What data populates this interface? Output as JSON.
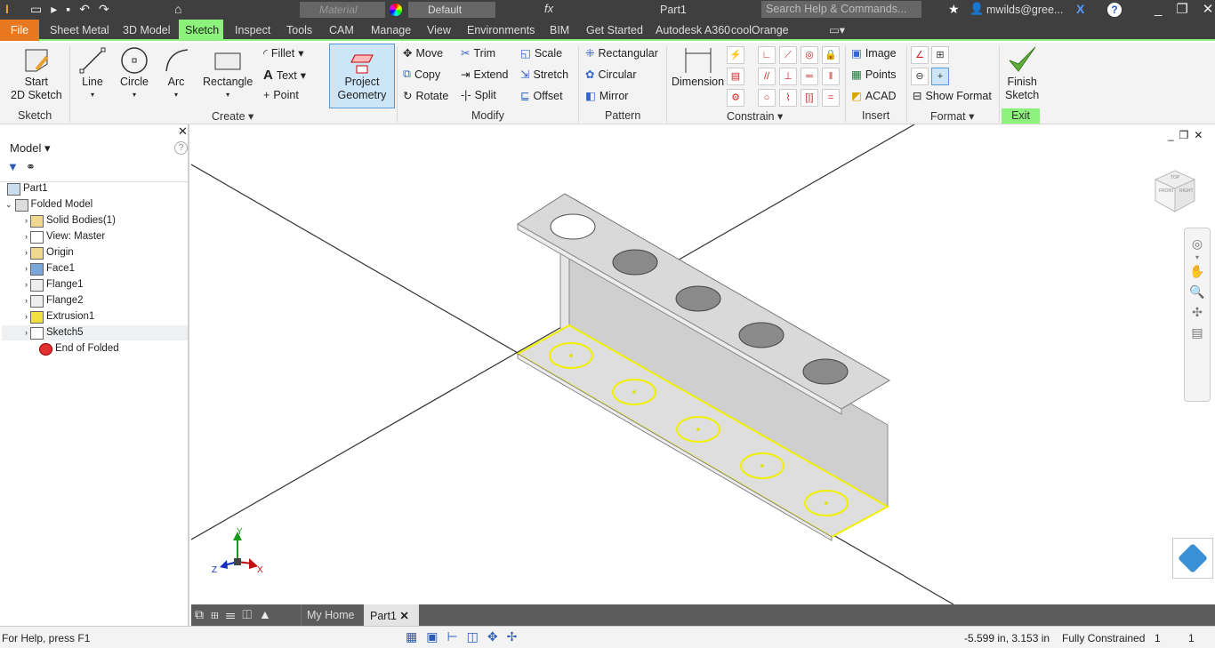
{
  "titlebar": {
    "doc_title": "Part1",
    "material_placeholder": "Material",
    "appearance": "Default",
    "search_placeholder": "Search Help & Commands...",
    "user": "mwilds@gree...",
    "help": "?"
  },
  "tabs": [
    {
      "label": "File"
    },
    {
      "label": "Sheet Metal"
    },
    {
      "label": "3D Model"
    },
    {
      "label": "Sketch",
      "active": true
    },
    {
      "label": "Inspect"
    },
    {
      "label": "Tools"
    },
    {
      "label": "CAM"
    },
    {
      "label": "Manage"
    },
    {
      "label": "View"
    },
    {
      "label": "Environments"
    },
    {
      "label": "BIM"
    },
    {
      "label": "Get Started"
    },
    {
      "label": "Autodesk A360"
    },
    {
      "label": "coolOrange"
    }
  ],
  "ribbon": {
    "sketch": {
      "start": "Start",
      "start2": "2D Sketch",
      "group": "Sketch"
    },
    "create": {
      "line": "Line",
      "circle": "Circle",
      "arc": "Arc",
      "rectangle": "Rectangle",
      "fillet": "Fillet",
      "text": "Text",
      "point": "Point",
      "project": "Project",
      "project2": "Geometry",
      "group": "Create"
    },
    "modify": {
      "move": "Move",
      "copy": "Copy",
      "rotate": "Rotate",
      "trim": "Trim",
      "extend": "Extend",
      "split": "Split",
      "scale": "Scale",
      "stretch": "Stretch",
      "offset": "Offset",
      "group": "Modify"
    },
    "pattern": {
      "rectangular": "Rectangular",
      "circular": "Circular",
      "mirror": "Mirror",
      "group": "Pattern"
    },
    "constrain": {
      "dimension": "Dimension",
      "group": "Constrain"
    },
    "insert": {
      "image": "Image",
      "points": "Points",
      "acad": "ACAD",
      "group": "Insert"
    },
    "format": {
      "show_format": "Show Format",
      "group": "Format"
    },
    "exit": {
      "finish": "Finish",
      "finish2": "Sketch",
      "group": "Exit"
    }
  },
  "browser": {
    "title": "Model",
    "help": "?",
    "nodes": [
      {
        "label": "Part1",
        "level": 0
      },
      {
        "label": "Folded Model",
        "level": 1
      },
      {
        "label": "Solid Bodies(1)",
        "level": 2
      },
      {
        "label": "View: Master",
        "level": 2
      },
      {
        "label": "Origin",
        "level": 2
      },
      {
        "label": "Face1",
        "level": 2
      },
      {
        "label": "Flange1",
        "level": 2
      },
      {
        "label": "Flange2",
        "level": 2
      },
      {
        "label": "Extrusion1",
        "level": 2
      },
      {
        "label": "Sketch5",
        "level": 2,
        "selected": true
      },
      {
        "label": "End of Folded",
        "level": 2
      }
    ]
  },
  "triad": {
    "x": "X",
    "y": "Y",
    "z": "Z"
  },
  "viewcube": {
    "front": "FRONT",
    "right": "RIGHT",
    "top": "TOP"
  },
  "doctabs": {
    "home": "My Home",
    "part": "Part1"
  },
  "status": {
    "help": "For Help, press F1",
    "coords": "-5.599 in, 3.153 in",
    "constraint": "Fully Constrained",
    "count1": "1",
    "count2": "1"
  },
  "colors": {
    "file_tab": "#e8781f",
    "active_tab": "#8cf27c",
    "sketch": "#f0f000"
  }
}
